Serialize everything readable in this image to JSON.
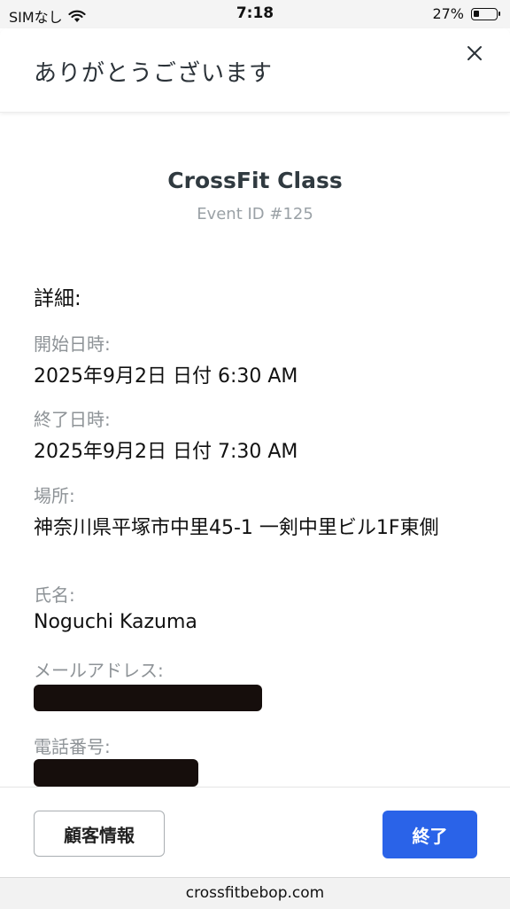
{
  "status_bar": {
    "carrier": "SIMなし",
    "time": "7:18",
    "battery_percent": "27%",
    "battery_level": 0.27,
    "icons": [
      "wifi-icon",
      "battery-icon"
    ]
  },
  "modal": {
    "title": "ありがとうございます",
    "close_icon": "close-icon"
  },
  "event": {
    "name": "CrossFit Class",
    "id_text": "Event ID #125"
  },
  "details": {
    "heading": "詳細:",
    "start_label": "開始日時:",
    "start_value": "2025年9月2日 日付 6:30 AM",
    "end_label": "終了日時:",
    "end_value": "2025年9月2日 日付 7:30 AM",
    "location_label": "場所:",
    "location_value": "神奈川県平塚市中里45-1 一剣中里ビル1F東側",
    "name_label": "氏名:",
    "name_value": "Noguchi Kazuma",
    "email_label": "メールアドレス:",
    "phone_label": "電話番号:"
  },
  "footer": {
    "customer_info_button": "顧客情報",
    "finish_button": "終了",
    "primary_color": "#2a63e8"
  },
  "browser": {
    "url": "crossfitbebop.com"
  }
}
